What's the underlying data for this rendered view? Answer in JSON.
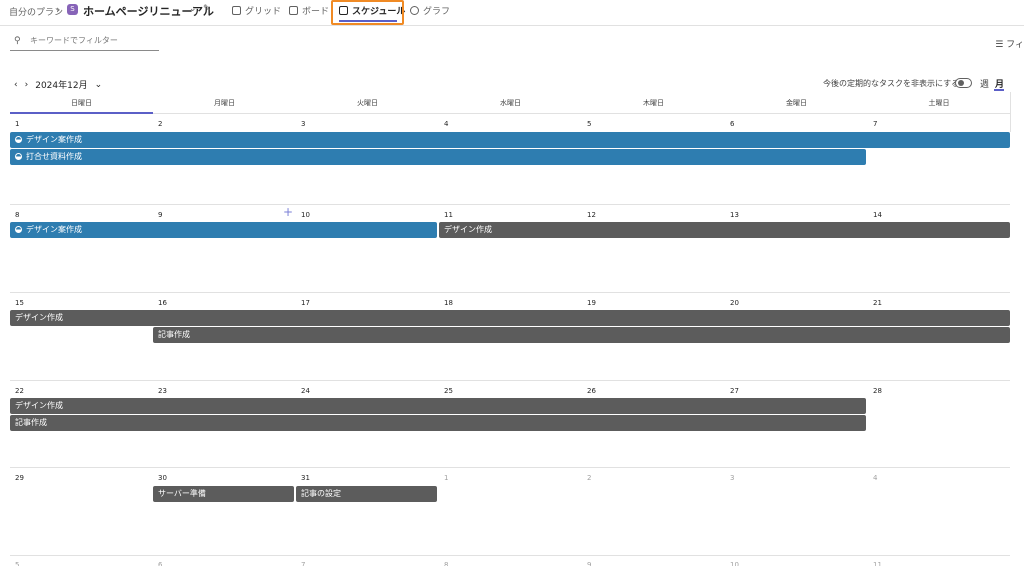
{
  "header": {
    "crumb": "自分のプラン",
    "plan_badge": "S",
    "plan_title": "ホームページリニューアル",
    "tabs": [
      {
        "label": "グリッド"
      },
      {
        "label": "ボード"
      },
      {
        "label": "スケジュール"
      },
      {
        "label": "グラフ"
      }
    ]
  },
  "filter": {
    "placeholder": "キーワードでフィルター",
    "right_label": "フィ"
  },
  "calendar": {
    "month_label": "2024年12月",
    "toggle_label": "今後の定期的なタスクを非表示にする",
    "view_week": "週",
    "view_month": "月",
    "day_headers": [
      "日曜日",
      "月曜日",
      "火曜日",
      "水曜日",
      "木曜日",
      "金曜日",
      "土曜日"
    ],
    "weeks": [
      [
        "1",
        "2",
        "3",
        "4",
        "5",
        "6",
        "7"
      ],
      [
        "8",
        "9",
        "10",
        "11",
        "12",
        "13",
        "14"
      ],
      [
        "15",
        "16",
        "17",
        "18",
        "19",
        "20",
        "21"
      ],
      [
        "22",
        "23",
        "24",
        "25",
        "26",
        "27",
        "28"
      ],
      [
        "29",
        "30",
        "31",
        "1",
        "2",
        "3",
        "4"
      ],
      [
        "5",
        "6",
        "7",
        "8",
        "9",
        "10",
        "11"
      ]
    ],
    "tasks": {
      "w1a": "デザイン案作成",
      "w1b": "打合せ資料作成",
      "w2a": "デザイン案作成",
      "w2b": "デザイン作成",
      "w3a": "デザイン作成",
      "w3b": "記事作成",
      "w4a": "デザイン作成",
      "w4b": "記事作成",
      "w5a": "サーバー準備",
      "w5b": "記事の設定"
    }
  },
  "colors": {
    "accent": "#5b5fc7",
    "task_blue": "#2e7db0",
    "task_gray": "#5c5c5c",
    "highlight": "#f08a24"
  }
}
